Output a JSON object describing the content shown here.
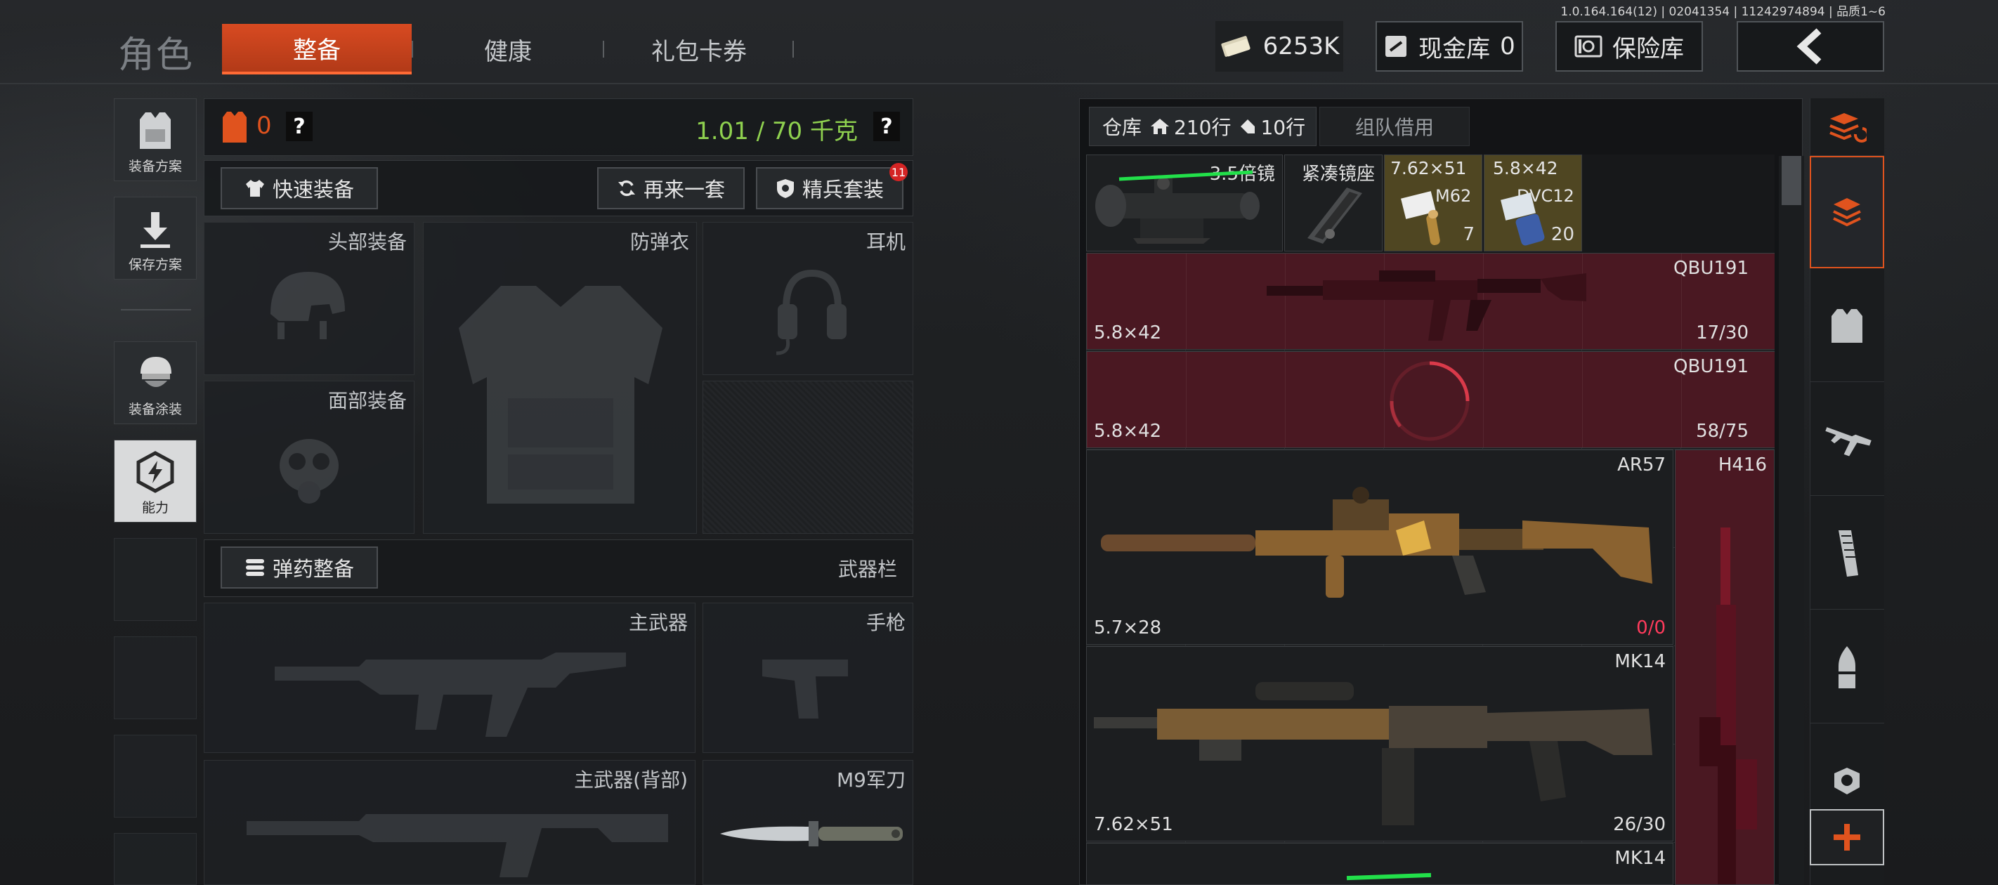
{
  "version": "1.0.164.164(12) | 02041354 | 11242974894 | 品质1~6",
  "brand": "角色",
  "tabs": [
    {
      "label": "整备"
    },
    {
      "label": "健康"
    },
    {
      "label": "礼包卡券"
    }
  ],
  "currency": {
    "amount": "6253K"
  },
  "cash_vault": {
    "label": "现金库",
    "value": "0"
  },
  "safe": {
    "label": "保险库"
  },
  "left_menu": [
    {
      "label": "装备方案",
      "icon": "vest-icon"
    },
    {
      "label": "保存方案",
      "icon": "download-icon"
    },
    {
      "label": "装备涂装",
      "icon": "helmet-paint-icon"
    },
    {
      "label": "能力",
      "icon": "ability-icon"
    }
  ],
  "loadout": {
    "armor_count": "0",
    "help": "?",
    "weight": "1.01 / 70 千克",
    "quick_equip": "快速装备",
    "again": "再来一套",
    "elite": "精兵套装",
    "elite_badge": "11",
    "slots": {
      "head": "头部装备",
      "vest": "防弹衣",
      "headset": "耳机",
      "face": "面部装备"
    },
    "ammo_button": "弹药整备",
    "weapon_bar": "武器栏",
    "weapon_slots": {
      "primary": "主武器",
      "pistol": "手枪",
      "primary_back": "主武器(背部)",
      "knife": "M9军刀"
    }
  },
  "warehouse": {
    "title": "仓库",
    "rows": "210行",
    "rows_icon": "home-icon",
    "extra": "10行",
    "extra_icon": "tag-icon",
    "team_tab": "组队借用",
    "top_items": [
      {
        "name": "3.5倍镜",
        "icon": "scope-icon"
      },
      {
        "name": "紧凑镜座",
        "icon": "mount-icon"
      },
      {
        "name": "7.62×51",
        "sub": "M62",
        "count": "7",
        "icon": "ammo-icon"
      },
      {
        "name": "5.8×42",
        "sub": "DVC12",
        "count": "20",
        "icon": "ammo-icon"
      }
    ],
    "weapons": [
      {
        "name": "QBU191",
        "caliber": "5.8×42",
        "count": "17/30"
      },
      {
        "name": "QBU191",
        "caliber": "5.8×42",
        "count": "58/75"
      },
      {
        "name": "AR57",
        "caliber": "5.7×28",
        "count": "0/0"
      },
      {
        "name": "H416"
      },
      {
        "name": "MK14",
        "caliber": "7.62×51",
        "count": "26/30"
      },
      {
        "name": "MK14"
      }
    ]
  },
  "right_rail": [
    "layers-refresh-icon",
    "layers-icon",
    "vest-icon",
    "rifle-icon",
    "magazine-icon",
    "bullet-icon",
    "sight-icon",
    "plus-icon"
  ],
  "colors": {
    "accent": "#d84a21",
    "weight": "#8fd14f",
    "danger": "#ff3b5c",
    "weapon_bg": "#5b1d28",
    "ammo_bg": "#4f4622"
  }
}
